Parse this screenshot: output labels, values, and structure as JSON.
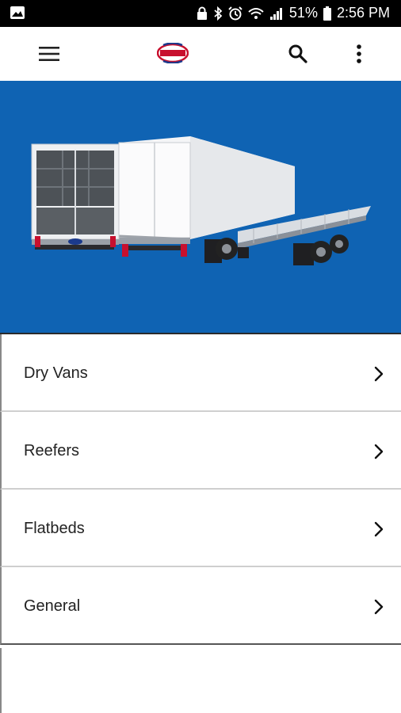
{
  "status_bar": {
    "battery": "51%",
    "time": "2:56 PM",
    "icons": [
      "image-icon",
      "lock-icon",
      "bluetooth-icon",
      "alarm-icon",
      "wifi-icon",
      "signal-icon",
      "battery-icon"
    ]
  },
  "app_bar": {
    "icons": [
      "menu-icon",
      "brand-logo",
      "search-icon",
      "more-vert-icon"
    ]
  },
  "hero": {
    "image": "trailer-lineup-image",
    "background": "#0f63b3"
  },
  "categories": [
    {
      "label": "Dry Vans"
    },
    {
      "label": "Reefers"
    },
    {
      "label": "Flatbeds"
    },
    {
      "label": "General"
    }
  ],
  "colors": {
    "accent": "#0f63b3",
    "text": "#222222",
    "divider": "#cfcfcf"
  }
}
